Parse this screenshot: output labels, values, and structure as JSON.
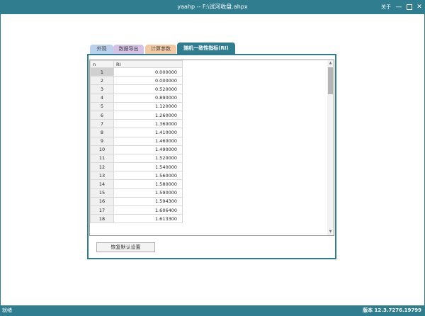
{
  "window": {
    "title": "yaahp -- F:\\试河收盘.ahpx",
    "about": "关于",
    "minimize": "—",
    "close": "✕"
  },
  "tabs": [
    {
      "label": "外观",
      "color": "#b9d1ec"
    },
    {
      "label": "数据导出",
      "color": "#d5c2e6"
    },
    {
      "label": "计算参数",
      "color": "#f4c9a2"
    },
    {
      "label": "随机一致性指标(RI)",
      "color": "#2f7d8f",
      "active": true
    }
  ],
  "grid": {
    "columns": [
      "n",
      "RI"
    ],
    "rows": [
      {
        "n": "1",
        "ri": "0.000000"
      },
      {
        "n": "2",
        "ri": "0.000000"
      },
      {
        "n": "3",
        "ri": "0.520000"
      },
      {
        "n": "4",
        "ri": "0.890000"
      },
      {
        "n": "5",
        "ri": "1.120000"
      },
      {
        "n": "6",
        "ri": "1.260000"
      },
      {
        "n": "7",
        "ri": "1.360000"
      },
      {
        "n": "8",
        "ri": "1.410000"
      },
      {
        "n": "9",
        "ri": "1.460000"
      },
      {
        "n": "10",
        "ri": "1.490000"
      },
      {
        "n": "11",
        "ri": "1.520000"
      },
      {
        "n": "12",
        "ri": "1.540000"
      },
      {
        "n": "13",
        "ri": "1.560000"
      },
      {
        "n": "14",
        "ri": "1.580000"
      },
      {
        "n": "15",
        "ri": "1.590000"
      },
      {
        "n": "16",
        "ri": "1.594300"
      },
      {
        "n": "17",
        "ri": "1.606400"
      },
      {
        "n": "18",
        "ri": "1.613300"
      }
    ]
  },
  "reset_button": "恢复默认设置",
  "status": {
    "left": "就绪",
    "version": "版本 12.3.7276.19799"
  },
  "colors": {
    "accent": "#2f7d8f"
  }
}
